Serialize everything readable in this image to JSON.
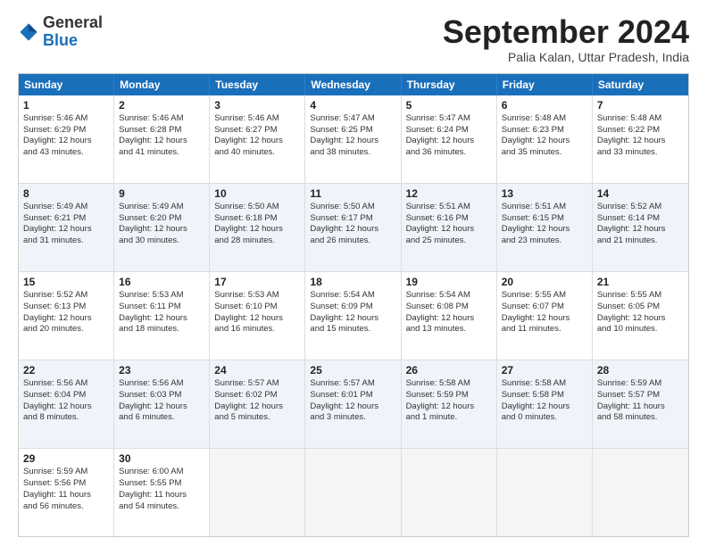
{
  "logo": {
    "general": "General",
    "blue": "Blue"
  },
  "header": {
    "month": "September 2024",
    "location": "Palia Kalan, Uttar Pradesh, India"
  },
  "weekdays": [
    "Sunday",
    "Monday",
    "Tuesday",
    "Wednesday",
    "Thursday",
    "Friday",
    "Saturday"
  ],
  "rows": [
    [
      null,
      {
        "day": 2,
        "lines": [
          "Sunrise: 5:46 AM",
          "Sunset: 6:28 PM",
          "Daylight: 12 hours",
          "and 41 minutes."
        ]
      },
      {
        "day": 3,
        "lines": [
          "Sunrise: 5:46 AM",
          "Sunset: 6:27 PM",
          "Daylight: 12 hours",
          "and 40 minutes."
        ]
      },
      {
        "day": 4,
        "lines": [
          "Sunrise: 5:47 AM",
          "Sunset: 6:25 PM",
          "Daylight: 12 hours",
          "and 38 minutes."
        ]
      },
      {
        "day": 5,
        "lines": [
          "Sunrise: 5:47 AM",
          "Sunset: 6:24 PM",
          "Daylight: 12 hours",
          "and 36 minutes."
        ]
      },
      {
        "day": 6,
        "lines": [
          "Sunrise: 5:48 AM",
          "Sunset: 6:23 PM",
          "Daylight: 12 hours",
          "and 35 minutes."
        ]
      },
      {
        "day": 7,
        "lines": [
          "Sunrise: 5:48 AM",
          "Sunset: 6:22 PM",
          "Daylight: 12 hours",
          "and 33 minutes."
        ]
      }
    ],
    [
      {
        "day": 1,
        "lines": [
          "Sunrise: 5:46 AM",
          "Sunset: 6:29 PM",
          "Daylight: 12 hours",
          "and 43 minutes."
        ]
      },
      {
        "day": 8,
        "lines": [
          "Sunrise: 5:49 AM",
          "Sunset: 6:21 PM",
          "Daylight: 12 hours",
          "and 31 minutes."
        ]
      },
      {
        "day": 9,
        "lines": [
          "Sunrise: 5:49 AM",
          "Sunset: 6:20 PM",
          "Daylight: 12 hours",
          "and 30 minutes."
        ]
      },
      {
        "day": 10,
        "lines": [
          "Sunrise: 5:50 AM",
          "Sunset: 6:18 PM",
          "Daylight: 12 hours",
          "and 28 minutes."
        ]
      },
      {
        "day": 11,
        "lines": [
          "Sunrise: 5:50 AM",
          "Sunset: 6:17 PM",
          "Daylight: 12 hours",
          "and 26 minutes."
        ]
      },
      {
        "day": 12,
        "lines": [
          "Sunrise: 5:51 AM",
          "Sunset: 6:16 PM",
          "Daylight: 12 hours",
          "and 25 minutes."
        ]
      },
      {
        "day": 13,
        "lines": [
          "Sunrise: 5:51 AM",
          "Sunset: 6:15 PM",
          "Daylight: 12 hours",
          "and 23 minutes."
        ]
      },
      {
        "day": 14,
        "lines": [
          "Sunrise: 5:52 AM",
          "Sunset: 6:14 PM",
          "Daylight: 12 hours",
          "and 21 minutes."
        ]
      }
    ],
    [
      {
        "day": 15,
        "lines": [
          "Sunrise: 5:52 AM",
          "Sunset: 6:13 PM",
          "Daylight: 12 hours",
          "and 20 minutes."
        ]
      },
      {
        "day": 16,
        "lines": [
          "Sunrise: 5:53 AM",
          "Sunset: 6:11 PM",
          "Daylight: 12 hours",
          "and 18 minutes."
        ]
      },
      {
        "day": 17,
        "lines": [
          "Sunrise: 5:53 AM",
          "Sunset: 6:10 PM",
          "Daylight: 12 hours",
          "and 16 minutes."
        ]
      },
      {
        "day": 18,
        "lines": [
          "Sunrise: 5:54 AM",
          "Sunset: 6:09 PM",
          "Daylight: 12 hours",
          "and 15 minutes."
        ]
      },
      {
        "day": 19,
        "lines": [
          "Sunrise: 5:54 AM",
          "Sunset: 6:08 PM",
          "Daylight: 12 hours",
          "and 13 minutes."
        ]
      },
      {
        "day": 20,
        "lines": [
          "Sunrise: 5:55 AM",
          "Sunset: 6:07 PM",
          "Daylight: 12 hours",
          "and 11 minutes."
        ]
      },
      {
        "day": 21,
        "lines": [
          "Sunrise: 5:55 AM",
          "Sunset: 6:05 PM",
          "Daylight: 12 hours",
          "and 10 minutes."
        ]
      }
    ],
    [
      {
        "day": 22,
        "lines": [
          "Sunrise: 5:56 AM",
          "Sunset: 6:04 PM",
          "Daylight: 12 hours",
          "and 8 minutes."
        ]
      },
      {
        "day": 23,
        "lines": [
          "Sunrise: 5:56 AM",
          "Sunset: 6:03 PM",
          "Daylight: 12 hours",
          "and 6 minutes."
        ]
      },
      {
        "day": 24,
        "lines": [
          "Sunrise: 5:57 AM",
          "Sunset: 6:02 PM",
          "Daylight: 12 hours",
          "and 5 minutes."
        ]
      },
      {
        "day": 25,
        "lines": [
          "Sunrise: 5:57 AM",
          "Sunset: 6:01 PM",
          "Daylight: 12 hours",
          "and 3 minutes."
        ]
      },
      {
        "day": 26,
        "lines": [
          "Sunrise: 5:58 AM",
          "Sunset: 5:59 PM",
          "Daylight: 12 hours",
          "and 1 minute."
        ]
      },
      {
        "day": 27,
        "lines": [
          "Sunrise: 5:58 AM",
          "Sunset: 5:58 PM",
          "Daylight: 12 hours",
          "and 0 minutes."
        ]
      },
      {
        "day": 28,
        "lines": [
          "Sunrise: 5:59 AM",
          "Sunset: 5:57 PM",
          "Daylight: 11 hours",
          "and 58 minutes."
        ]
      }
    ],
    [
      {
        "day": 29,
        "lines": [
          "Sunrise: 5:59 AM",
          "Sunset: 5:56 PM",
          "Daylight: 11 hours",
          "and 56 minutes."
        ]
      },
      {
        "day": 30,
        "lines": [
          "Sunrise: 6:00 AM",
          "Sunset: 5:55 PM",
          "Daylight: 11 hours",
          "and 54 minutes."
        ]
      },
      null,
      null,
      null,
      null,
      null
    ]
  ]
}
